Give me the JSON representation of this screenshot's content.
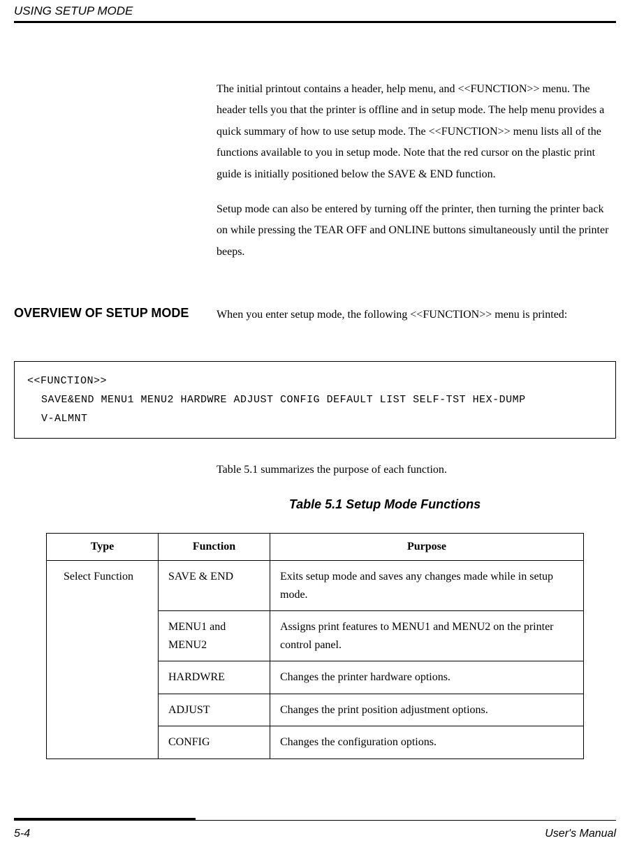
{
  "header": {
    "title": "USING SETUP MODE"
  },
  "body": {
    "para1": "The initial printout contains a header, help menu, and <<FUNCTION>> menu.  The header tells you  that the printer is offline and in setup mode.  The help menu provides a quick summary of how to use setup mode.  The <<FUNCTION>> menu lists all of the functions available to you in setup mode.  Note that the red cursor on the plastic print guide is initially positioned below the SAVE & END function.",
    "para2": "Setup mode can also be entered by turning off the printer, then turning the printer back on while pressing the TEAR OFF and ONLINE buttons simultaneously until the printer beeps."
  },
  "section": {
    "heading": "OVERVIEW OF SETUP MODE",
    "intro": "When you enter setup mode, the following <<FUNCTION>> menu is printed:"
  },
  "function_box": {
    "line1": "<<FUNCTION>>",
    "line2": "SAVE&END  MENU1  MENU2  HARDWRE  ADJUST  CONFIG  DEFAULT  LIST  SELF-TST  HEX-DUMP",
    "line3": "V-ALMNT"
  },
  "table": {
    "intro": "Table 5.1 summarizes the purpose of each function.",
    "caption": "Table 5.1  Setup Mode Functions",
    "headers": {
      "type": "Type",
      "function": "Function",
      "purpose": "Purpose"
    },
    "type_label": "Select Function",
    "rows": [
      {
        "function": "SAVE & END",
        "purpose": "Exits setup mode and saves any changes made while in setup mode."
      },
      {
        "function": "MENU1 and MENU2",
        "purpose": "Assigns print features to MENU1 and MENU2 on the printer control panel."
      },
      {
        "function": "HARDWRE",
        "purpose": "Changes the printer hardware options."
      },
      {
        "function": "ADJUST",
        "purpose": "Changes the print position adjustment options."
      },
      {
        "function": "CONFIG",
        "purpose": "Changes the configuration options."
      }
    ]
  },
  "footer": {
    "page": "5-4",
    "manual": "User's Manual"
  }
}
